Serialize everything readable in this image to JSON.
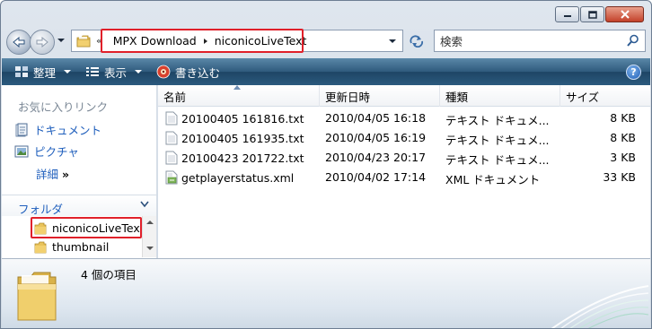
{
  "window": {
    "caption_buttons": [
      "minimize",
      "maximize",
      "close"
    ]
  },
  "address": {
    "history_chevron": "«",
    "crumbs": [
      "MPX Download",
      "niconicoLiveText"
    ],
    "search_placeholder": "検索"
  },
  "commandbar": {
    "organize": "整理",
    "views": "表示",
    "burn": "書き込む",
    "help": "?"
  },
  "navpane": {
    "favorites_title": "お気に入りリンク",
    "favorites": [
      "ドキュメント",
      "ピクチャ"
    ],
    "more": "詳細",
    "more_chevrons": "»",
    "folders_title": "フォルダ",
    "tree": [
      "niconicoLiveText",
      "thumbnail"
    ]
  },
  "columns": {
    "name": "名前",
    "date": "更新日時",
    "type": "種類",
    "size": "サイズ"
  },
  "files": [
    {
      "name": "20100405 161816.txt",
      "date": "2010/04/05 16:18",
      "type": "テキスト ドキュメ...",
      "size": "8 KB",
      "icon": "text-file-icon"
    },
    {
      "name": "20100405 161935.txt",
      "date": "2010/04/05 16:19",
      "type": "テキスト ドキュメ...",
      "size": "8 KB",
      "icon": "text-file-icon"
    },
    {
      "name": "20100423 201722.txt",
      "date": "2010/04/23 20:17",
      "type": "テキスト ドキュメ...",
      "size": "3 KB",
      "icon": "text-file-icon"
    },
    {
      "name": "getplayerstatus.xml",
      "date": "2010/04/02 17:14",
      "type": "XML ドキュメント",
      "size": "33 KB",
      "icon": "xml-file-icon"
    }
  ],
  "details": {
    "count": "4 個の項目"
  },
  "colors": {
    "highlight_box": "#e0202a",
    "link": "#1e5ebc",
    "commandbar": "#2b5a7e"
  }
}
